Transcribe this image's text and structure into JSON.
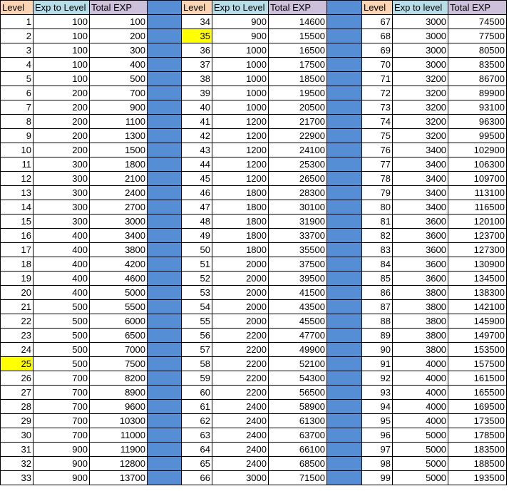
{
  "colors": {
    "level_header": "#fcd5b4",
    "exp_header": "#b7dee8",
    "total_header": "#ccc0da",
    "separator": "#558ed5",
    "highlight": "#ffff00"
  },
  "groups": [
    {
      "headers": [
        "Level",
        "Exp to Level",
        "Total EXP"
      ],
      "highlight_level": 25,
      "rows": [
        [
          1,
          100,
          100
        ],
        [
          2,
          100,
          200
        ],
        [
          3,
          100,
          300
        ],
        [
          4,
          100,
          400
        ],
        [
          5,
          100,
          500
        ],
        [
          6,
          200,
          700
        ],
        [
          7,
          200,
          900
        ],
        [
          8,
          200,
          1100
        ],
        [
          9,
          200,
          1300
        ],
        [
          10,
          200,
          1500
        ],
        [
          11,
          300,
          1800
        ],
        [
          12,
          300,
          2100
        ],
        [
          13,
          300,
          2400
        ],
        [
          14,
          300,
          2700
        ],
        [
          15,
          300,
          3000
        ],
        [
          16,
          400,
          3400
        ],
        [
          17,
          400,
          3800
        ],
        [
          18,
          400,
          4200
        ],
        [
          19,
          400,
          4600
        ],
        [
          20,
          400,
          5000
        ],
        [
          21,
          500,
          5500
        ],
        [
          22,
          500,
          6000
        ],
        [
          23,
          500,
          6500
        ],
        [
          24,
          500,
          7000
        ],
        [
          25,
          500,
          7500
        ],
        [
          26,
          700,
          8200
        ],
        [
          27,
          700,
          8900
        ],
        [
          28,
          700,
          9600
        ],
        [
          29,
          700,
          10300
        ],
        [
          30,
          700,
          11000
        ],
        [
          31,
          900,
          11900
        ],
        [
          32,
          900,
          12800
        ],
        [
          33,
          900,
          13700
        ]
      ]
    },
    {
      "headers": [
        "Level",
        "Exp to Level",
        "Total EXP"
      ],
      "highlight_level": 35,
      "rows": [
        [
          34,
          900,
          14600
        ],
        [
          35,
          900,
          15500
        ],
        [
          36,
          1000,
          16500
        ],
        [
          37,
          1000,
          17500
        ],
        [
          38,
          1000,
          18500
        ],
        [
          39,
          1000,
          19500
        ],
        [
          40,
          1000,
          20500
        ],
        [
          41,
          1200,
          21700
        ],
        [
          42,
          1200,
          22900
        ],
        [
          43,
          1200,
          24100
        ],
        [
          44,
          1200,
          25300
        ],
        [
          45,
          1200,
          26500
        ],
        [
          46,
          1800,
          28300
        ],
        [
          47,
          1800,
          30100
        ],
        [
          48,
          1800,
          31900
        ],
        [
          49,
          1800,
          33700
        ],
        [
          50,
          1800,
          35500
        ],
        [
          51,
          2000,
          37500
        ],
        [
          52,
          2000,
          39500
        ],
        [
          53,
          2000,
          41500
        ],
        [
          54,
          2000,
          43500
        ],
        [
          55,
          2000,
          45500
        ],
        [
          56,
          2200,
          47700
        ],
        [
          57,
          2200,
          49900
        ],
        [
          58,
          2200,
          52100
        ],
        [
          59,
          2200,
          54300
        ],
        [
          60,
          2200,
          56500
        ],
        [
          61,
          2400,
          58900
        ],
        [
          62,
          2400,
          61300
        ],
        [
          63,
          2400,
          63700
        ],
        [
          64,
          2400,
          66100
        ],
        [
          65,
          2400,
          68500
        ],
        [
          66,
          3000,
          71500
        ]
      ]
    },
    {
      "headers": [
        "Level",
        "Exp to level",
        "Total EXP"
      ],
      "highlight_level": null,
      "rows": [
        [
          67,
          3000,
          74500
        ],
        [
          68,
          3000,
          77500
        ],
        [
          69,
          3000,
          80500
        ],
        [
          70,
          3000,
          83500
        ],
        [
          71,
          3200,
          86700
        ],
        [
          72,
          3200,
          89900
        ],
        [
          73,
          3200,
          93100
        ],
        [
          74,
          3200,
          96300
        ],
        [
          75,
          3200,
          99500
        ],
        [
          76,
          3400,
          102900
        ],
        [
          77,
          3400,
          106300
        ],
        [
          78,
          3400,
          109700
        ],
        [
          79,
          3400,
          113100
        ],
        [
          80,
          3400,
          116500
        ],
        [
          81,
          3600,
          120100
        ],
        [
          82,
          3600,
          123700
        ],
        [
          83,
          3600,
          127300
        ],
        [
          84,
          3600,
          130900
        ],
        [
          85,
          3600,
          134500
        ],
        [
          86,
          3800,
          138300
        ],
        [
          87,
          3800,
          142100
        ],
        [
          88,
          3800,
          145900
        ],
        [
          89,
          3800,
          149700
        ],
        [
          90,
          3800,
          153500
        ],
        [
          91,
          4000,
          157500
        ],
        [
          92,
          4000,
          161500
        ],
        [
          93,
          4000,
          165500
        ],
        [
          94,
          4000,
          169500
        ],
        [
          95,
          4000,
          173500
        ],
        [
          96,
          5000,
          178500
        ],
        [
          97,
          5000,
          183500
        ],
        [
          98,
          5000,
          188500
        ],
        [
          99,
          5000,
          193500
        ]
      ]
    }
  ]
}
